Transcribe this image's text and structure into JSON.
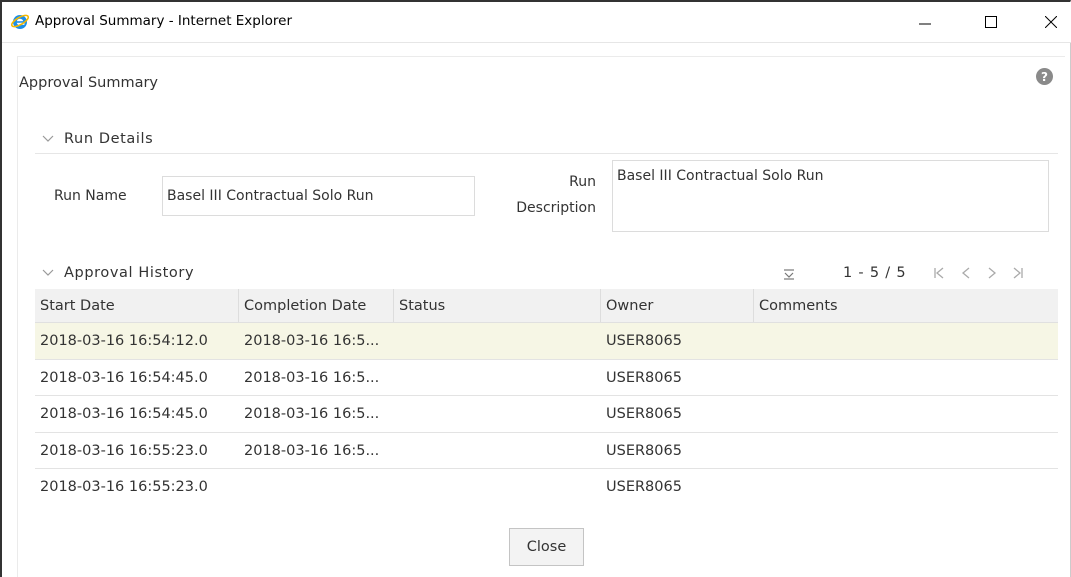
{
  "window": {
    "title": "Approval Summary - Internet Explorer"
  },
  "dialog": {
    "title": "Approval Summary",
    "help_icon": "help-icon"
  },
  "run_details": {
    "header": "Run Details",
    "run_name_label": "Run Name",
    "run_name_value": "Basel III Contractual Solo Run",
    "run_description_label_line1": "Run",
    "run_description_label_line2": "Description",
    "run_description_value": "Basel III Contractual Solo Run"
  },
  "approval_history": {
    "header": "Approval History",
    "pagination": "1 - 5 / 5",
    "columns": [
      "Start Date",
      "Completion Date",
      "Status",
      "Owner",
      "Comments"
    ],
    "rows": [
      {
        "start": "2018-03-16 16:54:12.0",
        "completion": "2018-03-16 16:5...",
        "status": "",
        "owner": "USER8065",
        "comments": ""
      },
      {
        "start": "2018-03-16 16:54:45.0",
        "completion": "2018-03-16 16:5...",
        "status": "",
        "owner": "USER8065",
        "comments": ""
      },
      {
        "start": "2018-03-16 16:54:45.0",
        "completion": "2018-03-16 16:5...",
        "status": "",
        "owner": "USER8065",
        "comments": ""
      },
      {
        "start": "2018-03-16 16:55:23.0",
        "completion": "2018-03-16 16:5...",
        "status": "",
        "owner": "USER8065",
        "comments": ""
      },
      {
        "start": "2018-03-16 16:55:23.0",
        "completion": "",
        "status": "",
        "owner": "USER8065",
        "comments": ""
      }
    ]
  },
  "close_label": "Close",
  "colors": {
    "selected_row": "#f6f6e5",
    "header_bg": "#f1f1f1",
    "ie_blue": "#1c8ee8",
    "ie_gold": "#f5b800"
  }
}
